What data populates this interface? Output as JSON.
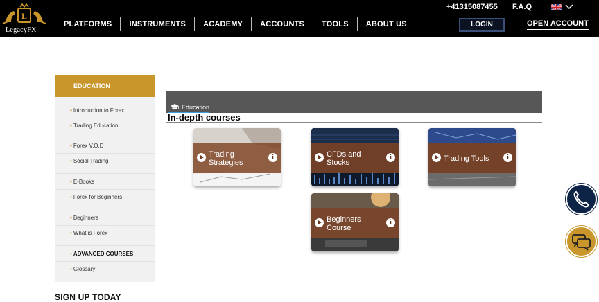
{
  "header": {
    "logo_text": "LegacyFX",
    "nav": [
      "PLATFORMS",
      "INSTRUMENTS",
      "ACADEMY",
      "ACCOUNTS",
      "TOOLS",
      "ABOUT US"
    ],
    "phone": "+41315087455",
    "faq": "F.A.Q",
    "login": "LOGIN",
    "open_account": "OPEN ACCOUNT"
  },
  "sidebar": {
    "heading": "EDUCATION",
    "items": [
      "Introduction to Forex",
      "Trading Education",
      "Forex V.O.D",
      "Social Trading",
      "E-Books",
      "Forex for Beginners",
      "Beginners",
      "What is Forex",
      "ADVANCED COURSES",
      "Glossary"
    ],
    "signup": "SIGN UP TODAY"
  },
  "main": {
    "banner_label": "Education",
    "section_title": "In-depth courses",
    "cards": [
      {
        "line1": "Trading",
        "line2": "Strategies"
      },
      {
        "line1": "CFDs and",
        "line2": "Stocks"
      },
      {
        "line1": "Trading Tools",
        "line2": ""
      },
      {
        "line1": "Beginners",
        "line2": "Course"
      }
    ]
  },
  "icons": {
    "education": "graduation-cap-icon",
    "play": "play-icon",
    "info": "info-icon",
    "phone": "phone-icon",
    "chat": "chat-icon"
  },
  "colors": {
    "accent_gold": "#c8962a",
    "banner_gray": "#575757",
    "card_overlay": "#804628",
    "phone_button": "#0d2446",
    "chat_button": "#c8962a"
  }
}
